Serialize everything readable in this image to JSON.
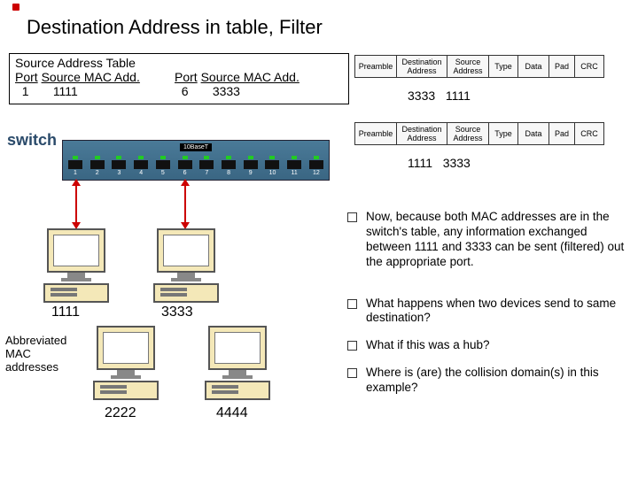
{
  "title": "Destination Address in table, Filter",
  "sat": {
    "title": "Source Address Table",
    "col_labels": {
      "port": "Port",
      "mac": "Source MAC Add."
    },
    "rows": [
      {
        "port": "1",
        "mac": "1111"
      },
      {
        "port": "6",
        "mac": "3333"
      }
    ]
  },
  "frame_headers": [
    "Preamble",
    "Destination\nAddress",
    "Source\nAddress",
    "Type",
    "Data",
    "Pad",
    "CRC"
  ],
  "frame_vals": {
    "top": {
      "da": "3333",
      "sa": "1111"
    },
    "bottom": {
      "da": "1111",
      "sa": "3333"
    }
  },
  "switch": {
    "label": "switch",
    "bar": "10BaseT",
    "ports": [
      "1",
      "2",
      "3",
      "4",
      "5",
      "6",
      "7",
      "8",
      "9",
      "10",
      "11",
      "12"
    ]
  },
  "pcs": {
    "a": "1111",
    "b": "2222",
    "c": "3333",
    "d": "4444"
  },
  "abbrev_note": "Abbreviated\nMAC\naddresses",
  "bullets": [
    "Now, because both MAC addresses are in the switch's table, any information exchanged between 1111 and 3333 can be sent (filtered) out the appropriate port.",
    "What happens when two devices send to same destination?",
    "What if this was a hub?",
    "Where is (are) the collision domain(s) in this example?"
  ]
}
